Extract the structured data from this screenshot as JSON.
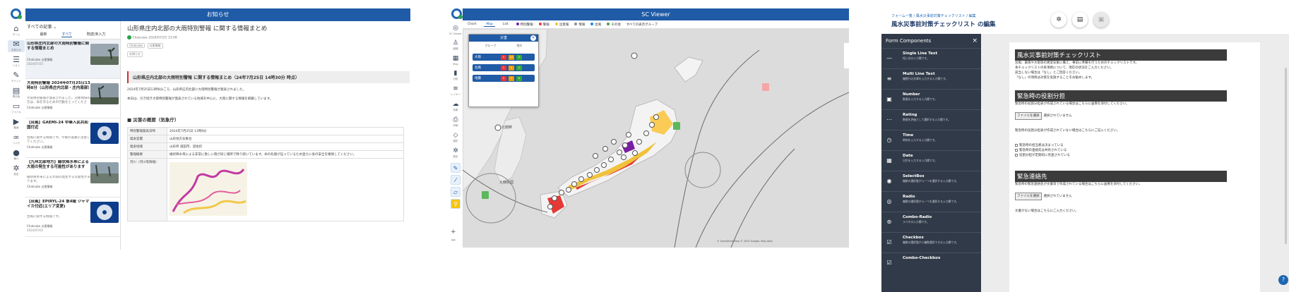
{
  "news_app": {
    "rail": [
      {
        "icon": "home",
        "label": "ホーム"
      },
      {
        "icon": "megaphone",
        "label": "お知らせ"
      },
      {
        "icon": "list",
        "label": "リスト"
      },
      {
        "icon": "chat",
        "label": "チャット"
      },
      {
        "icon": "board",
        "label": "掲示板"
      },
      {
        "icon": "folder",
        "label": "ファイル"
      },
      {
        "icon": "video",
        "label": "動画"
      },
      {
        "icon": "link",
        "label": "リンク"
      },
      {
        "icon": "person",
        "label": "個人"
      },
      {
        "icon": "gear",
        "label": "設定"
      }
    ],
    "header_title": "お知らせ",
    "list_filter": "すべての記事",
    "list_tabs": [
      "最新",
      "すべて",
      "既読/未入力"
    ],
    "items": [
      {
        "title": "山形県庄内北部の大雨特別警報に関する情報まとめ",
        "body": "",
        "tags": "Chatcube  災害情報",
        "meta": "2024/07/25"
      },
      {
        "title": "大雨特別警報 2024年07月25日13時8分（山形県庄内北部・庄内南部）",
        "body": "大雨特別警報が発表されました。対象地域の方は、命を守るための行動をとってください。",
        "tags": "Chatcube  災害情報",
        "meta": "2024/07/25"
      },
      {
        "title": "【台風】GAEMI-24 中華人民共和国付近",
        "body": "台風に関する情報です。今後の進路に注意してください。",
        "tags": "Chatcube  災害情報",
        "meta": "2024/07/24"
      },
      {
        "title": "【九州北部地方】線状降水帯による大雨の発生する可能性があります",
        "body": "線状降水帯による大雨の発生する可能性があります。",
        "tags": "Chatcube  災害情報",
        "meta": "2024/07/24"
      },
      {
        "title": "【台風】EPIRYL-24 第4報 ジャマイカ付近(エリア変更)",
        "body": "台風に関する情報です。",
        "tags": "Chatcube  災害情報",
        "meta": "2024/07/03"
      }
    ],
    "article": {
      "title": "山形県庄内北部の大雨特別警報 に関する情報まとめ",
      "author": "Chatcube",
      "date": "2024/07/25 13:08",
      "chips": [
        "Chatcube",
        "災害情報"
      ],
      "tag2": "お知らせ",
      "notice": "山形県庄内北部の大雨特別警報 に関する情報まとめ（24年7月25日 14時30分 時点）",
      "para1": "2024年7月25日13時8分ごろ、山形県庄内北部に大雨特別警報が発表されました。",
      "para2": "本日は、引き続き大雨特別警報が発表されている地域を中心に、大雨に関する情報を掲載しています。",
      "section": "■ 災害の概要（気象庁）",
      "rows": [
        {
          "k": "特別警報発表日時",
          "v": "2024年7月25日 13時8分"
        },
        {
          "k": "発表官署",
          "v": "山形地方気象台"
        },
        {
          "k": "発表地域",
          "v": "山形県 酒田市、遊佐町"
        },
        {
          "k": "警報概要",
          "v": "線状降水帯による非常に激しい雨が同じ場所で降り続いています。命の危険が迫っているため直ちに身の安全を確保してください。"
        },
        {
          "k": "河川（河川等情報）",
          "v": ""
        }
      ]
    }
  },
  "viewer_app": {
    "title": "SC Viewer",
    "rail": [
      {
        "icon": "viewer",
        "label": "SC Viewer"
      },
      {
        "icon": "hierarchy",
        "label": "組織"
      },
      {
        "icon": "map",
        "label": "Map"
      },
      {
        "icon": "chart",
        "label": "分析"
      },
      {
        "icon": "layers",
        "label": "レイヤー"
      },
      {
        "icon": "cloud",
        "label": "気象"
      },
      {
        "icon": "print",
        "label": "印刷"
      },
      {
        "icon": "shape",
        "label": "図形"
      },
      {
        "icon": "setting",
        "label": "設定"
      }
    ],
    "tabs": [
      "Chart",
      "Map",
      "List"
    ],
    "legend": [
      {
        "label": "特別警報",
        "color": "#7a1fa2"
      },
      {
        "label": "警報",
        "color": "#e53935"
      },
      {
        "label": "注意報",
        "color": "#fbc02d"
      },
      {
        "label": "情報",
        "color": "#8e8e8e"
      },
      {
        "label": "台風",
        "color": "#1e88e5"
      },
      {
        "label": "その他",
        "color": "#43a047"
      }
    ],
    "extra_label": "すべての表示グループ",
    "popup": {
      "title": "災害",
      "tabs": [
        "グループ",
        "地方"
      ],
      "rows": [
        {
          "name": "大雨",
          "v1": "5",
          "v2": "12",
          "v3": "3"
        },
        {
          "name": "台風",
          "v1": "1",
          "v2": "4",
          "v3": "2"
        },
        {
          "name": "地震",
          "v1": "0",
          "v2": "2",
          "v3": "6"
        }
      ]
    },
    "map_labels": [
      {
        "text": "北朝鮮",
        "icon": "label"
      },
      {
        "text": "大韓民国",
        "icon": "label"
      }
    ],
    "attribution": "© OpenStreetMap © 2024 Google, Map data"
  },
  "form_app": {
    "breadcrumb": "フォーム一覧 / 風水災事前対策チェックリスト / 編集",
    "page_title": "風水災事前対策チェックリスト の編集",
    "toolbar": [
      "settings",
      "preview",
      "save"
    ],
    "components_title": "Form Components",
    "components": [
      {
        "icon": "short-text",
        "name": "Single Line Text",
        "desc": "短い文の入力欄です。"
      },
      {
        "icon": "long-text",
        "name": "Multi Line Text",
        "desc": "複数行の文章を入力する入力欄です。"
      },
      {
        "icon": "number",
        "name": "Number",
        "desc": "数値を入力する入力欄です。"
      },
      {
        "icon": "rating",
        "name": "Rating",
        "desc": "数値を評価として選択する入力欄です。"
      },
      {
        "icon": "time",
        "name": "Time",
        "desc": "時刻を入力する入力欄です。"
      },
      {
        "icon": "date",
        "name": "Date",
        "desc": "日付を入力する入力欄です。"
      },
      {
        "icon": "select",
        "name": "SelectBox",
        "desc": "複数の選択肢から一つを選択する入力欄です。"
      },
      {
        "icon": "radio",
        "name": "Radio",
        "desc": "複数の選択肢から一つを選択する入力欄です。"
      },
      {
        "icon": "combo-radio",
        "name": "Combo-Radio",
        "desc": "ラジオの入力欄です。"
      },
      {
        "icon": "checkbox",
        "name": "Checkbox",
        "desc": "複数の選択肢から複数選択できる入力欄です。"
      },
      {
        "icon": "combo-checkbox",
        "name": "Combo-Checkbox",
        "desc": ""
      }
    ],
    "sections": [
      {
        "heading": "風水災事前対策チェックリスト",
        "lines": [
          "台風、豪雨や大雨等の異常気象に備え、事前に準備を行うためのチェックリストです。",
          "本チェックリストの各項目について、現在の状況をご入力ください。",
          "該当しない場合は「なし」とご回答ください。",
          "「なし」の項目は対策を実施することをお勧めします。"
        ]
      },
      {
        "heading": "緊急時の役割分担",
        "lines": [
          "緊急時の役割分担表が作成されている場合はこちらに画像を添付してください。"
        ],
        "file_button": "ファイルを選択",
        "file_status": "選択されていません",
        "after": "緊急時の役割分担表が作成されていない場合はこちらにご記入ください。",
        "checks": [
          "緊急時の担当者は決まっている",
          "緊急時の連絡先は共有されている",
          "役割分担が定期的に見直されている"
        ]
      },
      {
        "heading": "緊急連絡先",
        "lines": [
          "緊急時の緊急連絡先が文書等で作成されている場合はこちらに画像を添付してください。"
        ],
        "file_button": "ファイルを選択",
        "file_status": "選択されていません",
        "after": "文書がない場合はこちらにご入力ください。"
      }
    ],
    "help": "?"
  }
}
